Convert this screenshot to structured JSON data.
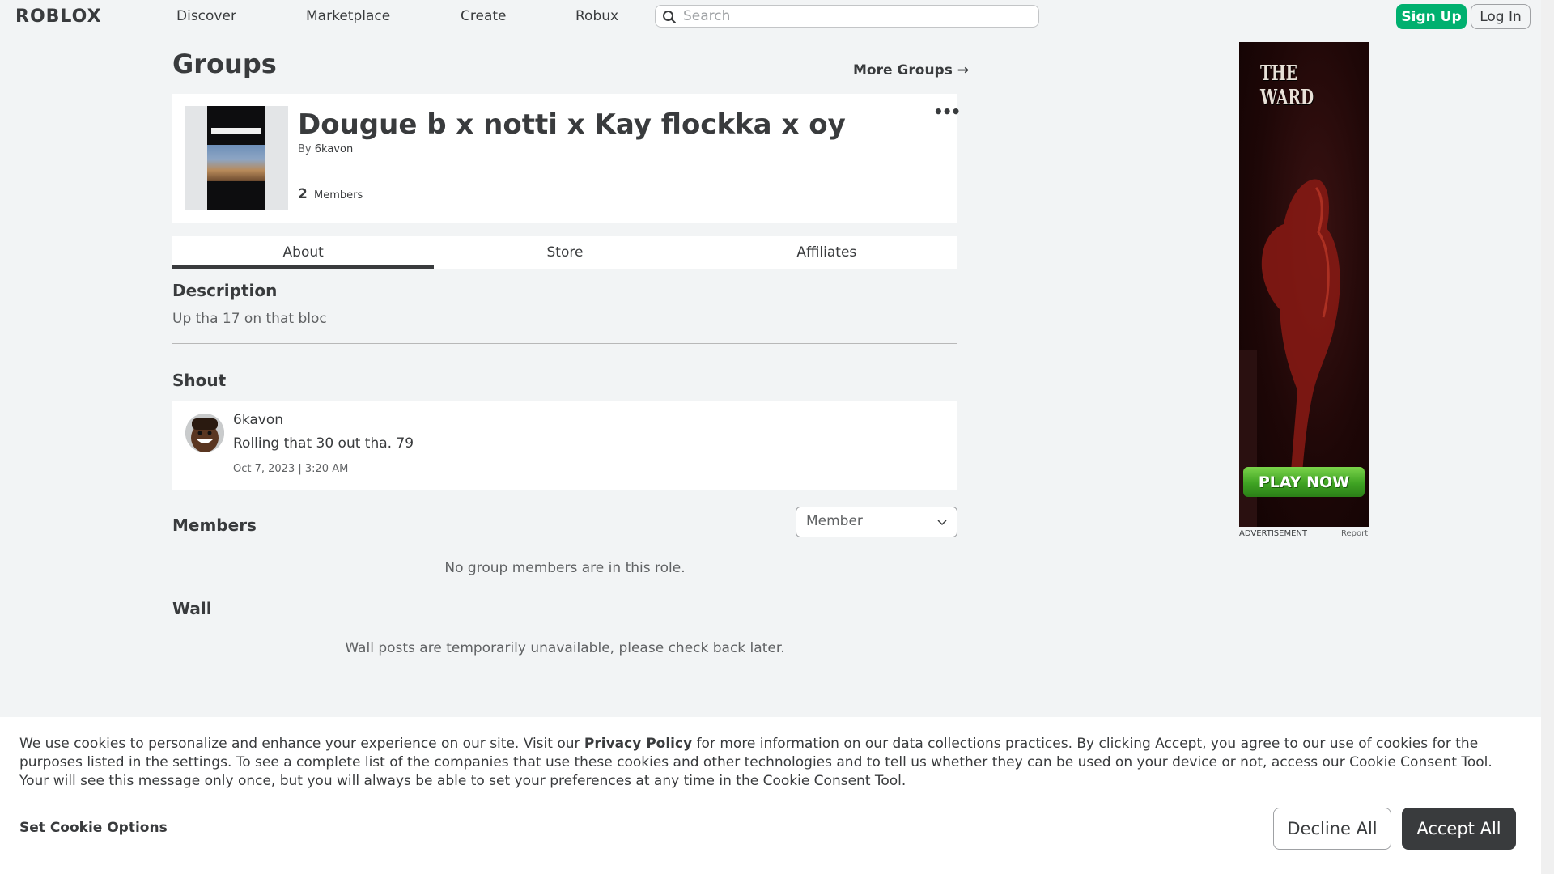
{
  "nav": {
    "logo": "ROBLOX",
    "links": [
      "Discover",
      "Marketplace",
      "Create",
      "Robux"
    ],
    "search_placeholder": "Search",
    "signup_label": "Sign Up",
    "login_label": "Log In"
  },
  "page": {
    "title": "Groups",
    "more_groups": "More Groups →"
  },
  "group": {
    "name": "Dougue b x notti x Kay flockka x oy",
    "by_label": "By",
    "owner": "6kavon",
    "member_count": "2",
    "members_label": "Members",
    "more_icon": "•••"
  },
  "tabs": [
    {
      "label": "About",
      "active": true
    },
    {
      "label": "Store",
      "active": false
    },
    {
      "label": "Affiliates",
      "active": false
    }
  ],
  "description": {
    "heading": "Description",
    "text": "Up tha 17 on that bloc"
  },
  "shout": {
    "heading": "Shout",
    "user": "6kavon",
    "text": "Rolling that 30 out tha. 79",
    "date": "Oct 7, 2023 | 3:20 AM"
  },
  "members": {
    "heading": "Members",
    "role_selected": "Member",
    "empty_text": "No group members are in this role."
  },
  "wall": {
    "heading": "Wall",
    "empty_text": "Wall posts are temporarily unavailable, please check back later."
  },
  "ad": {
    "logo_line1": "THE",
    "logo_line2": "WARD",
    "cta": "PLAY NOW",
    "label": "ADVERTISEMENT",
    "report": "Report"
  },
  "cookie": {
    "text_before": "We use cookies to personalize and enhance your experience on our site. Visit our ",
    "privacy_link": "Privacy Policy",
    "text_after": " for more information on our data collections practices. By clicking Accept, you agree to our use of cookies for the purposes listed in the settings. To see a complete list of the companies that use these cookies and other technologies and to tell us whether they can be used on your device or not, access our Cookie Consent Tool. Your will see this message only once, but you will always be able to set your preferences at any time in the Cookie Consent Tool.",
    "options_label": "Set Cookie Options",
    "decline_label": "Decline All",
    "accept_label": "Accept All"
  },
  "colors": {
    "accent_green": "#00b06f",
    "text_primary": "#393b3d",
    "background": "#f2f4f5"
  }
}
